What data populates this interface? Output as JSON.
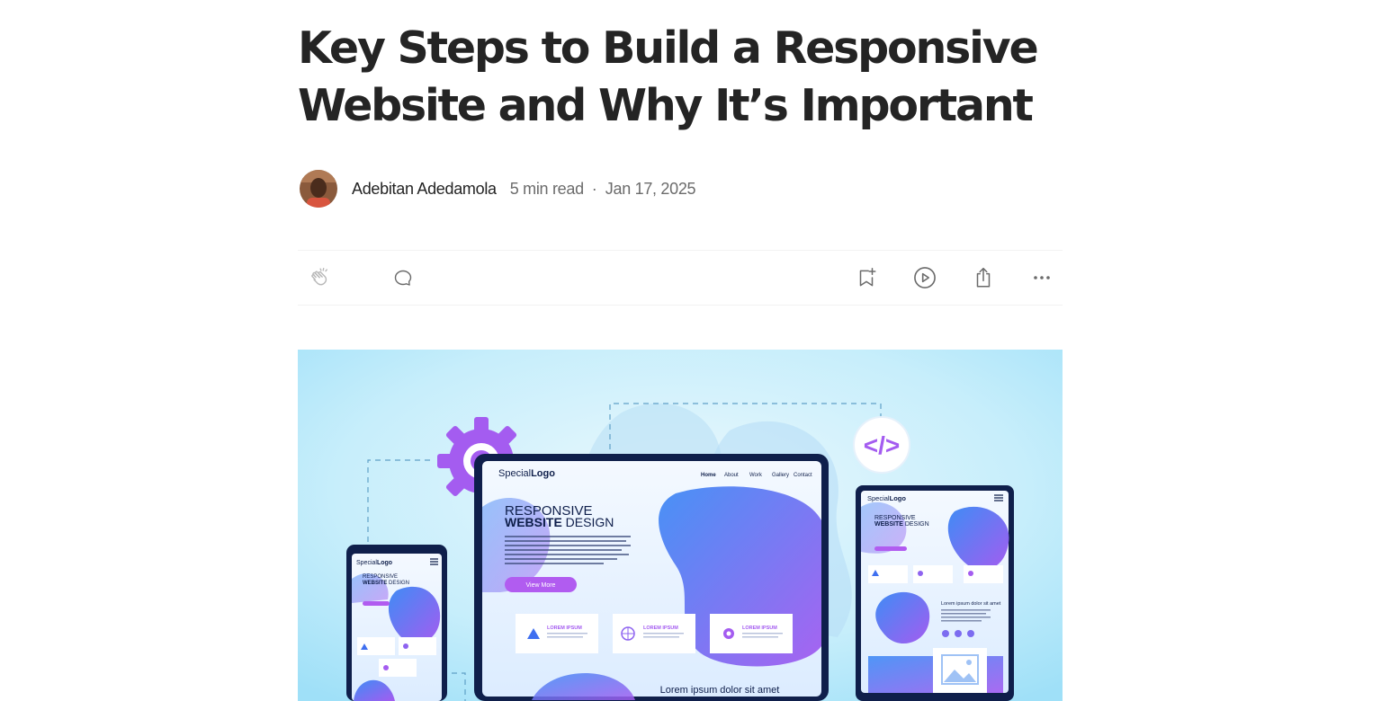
{
  "article": {
    "title": "Key Steps to Build a Responsive Website and Why It’s Important",
    "author": "Adebitan Adedamola",
    "read_time": "5 min read",
    "separator": "·",
    "date": "Jan 17, 2025"
  },
  "actions": {
    "icons": [
      "clap-icon",
      "comment-icon",
      "bookmark-add-icon",
      "play-icon",
      "share-icon",
      "more-icon"
    ]
  },
  "hero": {
    "logo_prefix": "Special",
    "logo_suffix": "Logo",
    "nav": [
      "Home",
      "About",
      "Work",
      "Gallery",
      "Contact"
    ],
    "headline_line1": "RESPONSIVE",
    "headline_line2_bold": "WEBSITE",
    "headline_line2_rest": " DESIGN",
    "cta": "View More",
    "card_title": "LOREM IPSUM",
    "footer_text": "Lorem ipsum dolor sit amet",
    "code_symbol": "</>"
  },
  "colors": {
    "text_primary": "#242424",
    "text_secondary": "#6b6b6b",
    "accent_purple": "#a45cf0",
    "hero_bg": "#aee6fb"
  }
}
